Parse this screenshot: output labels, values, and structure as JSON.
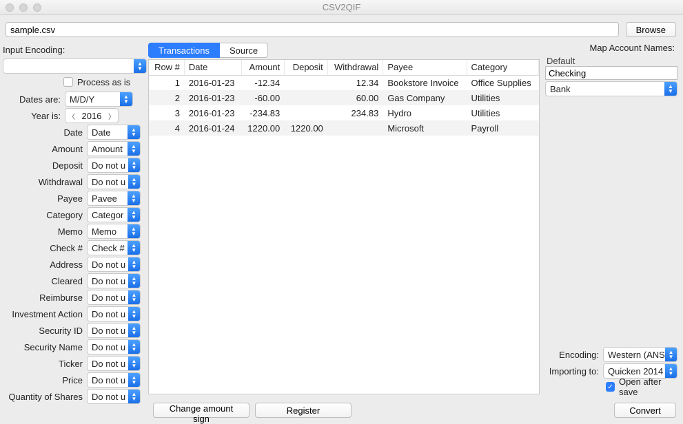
{
  "window": {
    "title": "CSV2QIF"
  },
  "file": {
    "path": "sample.csv",
    "browse": "Browse"
  },
  "left": {
    "input_encoding_label": "Input Encoding:",
    "input_encoding_value": "",
    "process_as_is_label": "Process as is",
    "dates_are_label": "Dates are:",
    "dates_are_value": "M/D/Y",
    "year_is_label": "Year is:",
    "year_is_value": "2016",
    "fields": [
      {
        "label": "Date",
        "value": "Date"
      },
      {
        "label": "Amount",
        "value": "Amount"
      },
      {
        "label": "Deposit",
        "value": "Do not u"
      },
      {
        "label": "Withdrawal",
        "value": "Do not u"
      },
      {
        "label": "Payee",
        "value": "Pavee"
      },
      {
        "label": "Category",
        "value": "Categor"
      },
      {
        "label": "Memo",
        "value": "Memo"
      },
      {
        "label": "Check #",
        "value": "Check #"
      },
      {
        "label": "Address",
        "value": "Do not u"
      },
      {
        "label": "Cleared",
        "value": "Do not u"
      },
      {
        "label": "Reimburse",
        "value": "Do not u"
      },
      {
        "label": "Investment Action",
        "value": "Do not u"
      },
      {
        "label": "Security ID",
        "value": "Do not u"
      },
      {
        "label": "Security Name",
        "value": "Do not u"
      },
      {
        "label": "Ticker",
        "value": "Do not u"
      },
      {
        "label": "Price",
        "value": "Do not u"
      },
      {
        "label": "Quantity of Shares",
        "value": "Do not u"
      }
    ]
  },
  "tabs": {
    "transactions": "Transactions",
    "source": "Source"
  },
  "table": {
    "headers": [
      "Row #",
      "Date",
      "Amount",
      "Deposit",
      "Withdrawal",
      "Payee",
      "Category"
    ],
    "rows": [
      {
        "row": "1",
        "date": "2016-01-23",
        "amount": "-12.34",
        "deposit": "",
        "withdrawal": "12.34",
        "payee": "Bookstore Invoice",
        "category": "Office Supplies"
      },
      {
        "row": "2",
        "date": "2016-01-23",
        "amount": "-60.00",
        "deposit": "",
        "withdrawal": "60.00",
        "payee": "Gas Company",
        "category": "Utilities"
      },
      {
        "row": "3",
        "date": "2016-01-23",
        "amount": "-234.83",
        "deposit": "",
        "withdrawal": "234.83",
        "payee": "Hydro",
        "category": "Utilities"
      },
      {
        "row": "4",
        "date": "2016-01-24",
        "amount": "1220.00",
        "deposit": "1220.00",
        "withdrawal": "",
        "payee": "Microsoft",
        "category": "Payroll"
      }
    ]
  },
  "right": {
    "map_header": "Map Account Names:",
    "default_label": "Default",
    "default_value": "Checking",
    "acct_type_value": "Bank",
    "encoding_label": "Encoding:",
    "encoding_value": "Western (ANS",
    "importing_label": "Importing to:",
    "importing_value": "Quicken 2014",
    "open_after_label": "Open after save"
  },
  "bottom": {
    "change_sign": "Change amount sign",
    "register": "Register",
    "convert": "Convert"
  }
}
